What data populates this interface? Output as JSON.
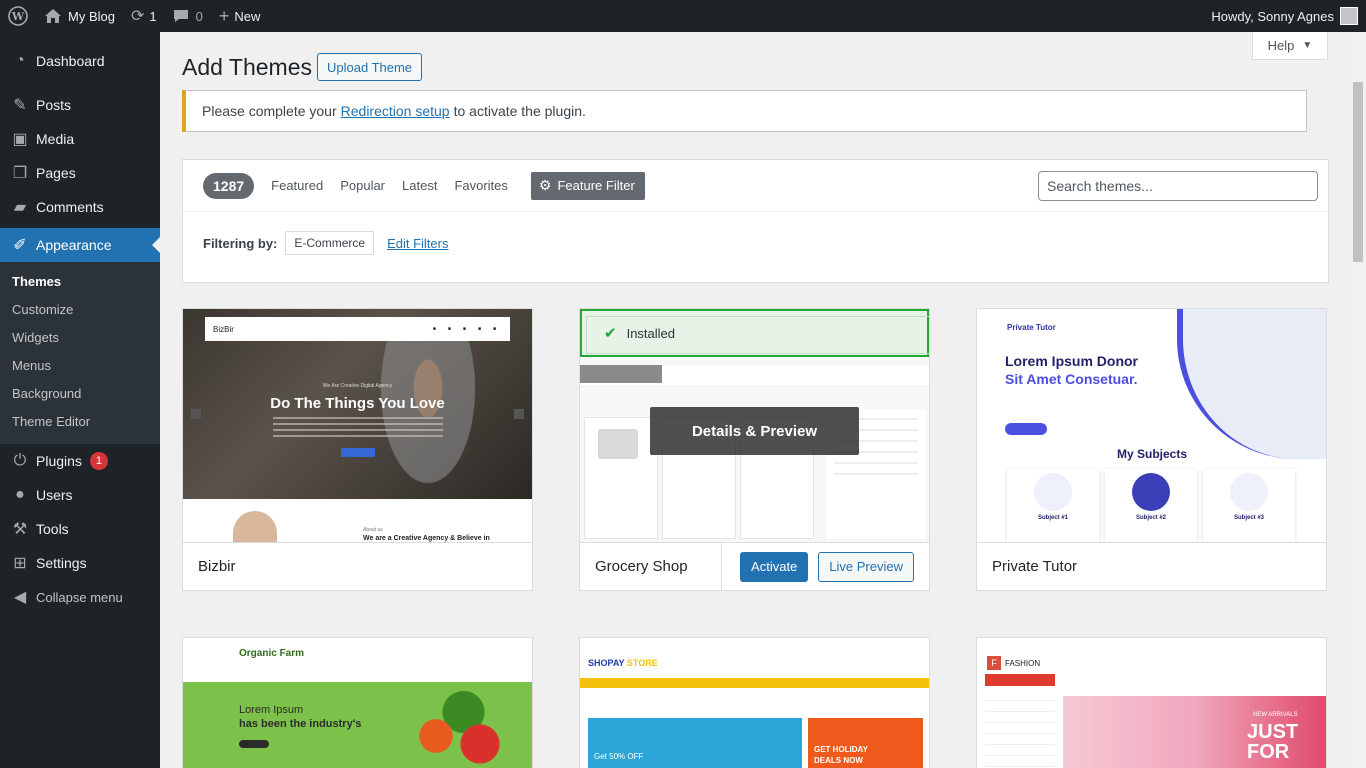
{
  "adminbar": {
    "site_name": "My Blog",
    "updates_count": "1",
    "comments_count": "0",
    "new_label": "New",
    "greeting": "Howdy, Sonny Agnes"
  },
  "sidebar": {
    "items": [
      {
        "label": "Dashboard",
        "icon": "dashboard-icon"
      },
      {
        "label": "Posts",
        "icon": "pin-icon"
      },
      {
        "label": "Media",
        "icon": "media-icon"
      },
      {
        "label": "Pages",
        "icon": "pages-icon"
      },
      {
        "label": "Comments",
        "icon": "comment-icon"
      },
      {
        "label": "Appearance",
        "icon": "brush-icon"
      },
      {
        "label": "Plugins",
        "icon": "plug-icon",
        "badge": "1"
      },
      {
        "label": "Users",
        "icon": "user-icon"
      },
      {
        "label": "Tools",
        "icon": "wrench-icon"
      },
      {
        "label": "Settings",
        "icon": "settings-icon"
      },
      {
        "label": "Collapse menu",
        "icon": "collapse-icon"
      }
    ],
    "appearance_sub": [
      "Themes",
      "Customize",
      "Widgets",
      "Menus",
      "Background",
      "Theme Editor"
    ]
  },
  "header": {
    "help": "Help",
    "title": "Add Themes",
    "upload_button": "Upload Theme"
  },
  "notice": {
    "prefix": "Please complete your",
    "link": "Redirection setup",
    "suffix": "to activate the plugin."
  },
  "filters": {
    "count": "1287",
    "tabs": [
      "Featured",
      "Popular",
      "Latest",
      "Favorites"
    ],
    "feature_filter": "Feature Filter",
    "search_placeholder": "Search themes...",
    "filtering_by": "Filtering by:",
    "tag": "E-Commerce",
    "edit_filters": "Edit Filters"
  },
  "themes": [
    {
      "name": "Bizbir",
      "screenshot_headline": "Do The Things You Love",
      "screenshot_sub": "We Are Creative Digital Agency",
      "screenshot_about": "About us",
      "screenshot_agency": "We are a Creative Agency & Believe in",
      "logo": "BizBir"
    },
    {
      "name": "Grocery Shop",
      "installed_label": "Installed",
      "overlay": "Details & Preview",
      "activate": "Activate",
      "live_preview": "Live Preview"
    },
    {
      "name": "Private Tutor",
      "logo": "Private Tutor",
      "headline1": "Lorem Ipsum Donor",
      "headline2": "Sit Amet Consetuar.",
      "subjects_title": "My Subjects",
      "subjects": [
        "Subject #1",
        "Subject #2",
        "Subject #3"
      ]
    },
    {
      "name": "Organic Farm",
      "logo": "Organic Farm",
      "line1": "Lorem Ipsum",
      "line2": "has been the industry's"
    },
    {
      "name": "Shopay Store",
      "logo_a": "SHOPAY",
      "logo_b": "STORE",
      "promo1": "Get 50% OFF",
      "promo2": "GET HOLIDAY DEALS NOW"
    },
    {
      "name": "Fashion",
      "logo": "FASHION",
      "new_arrivals": "NEW ARRIVALS",
      "just": "JUST",
      "for": "FOR"
    }
  ],
  "colors": {
    "accent": "#2271b1",
    "sidebar_bg": "#1d2327",
    "notice_border": "#dba617",
    "installed_border": "#22a837",
    "plugin_badge": "#d63638"
  }
}
